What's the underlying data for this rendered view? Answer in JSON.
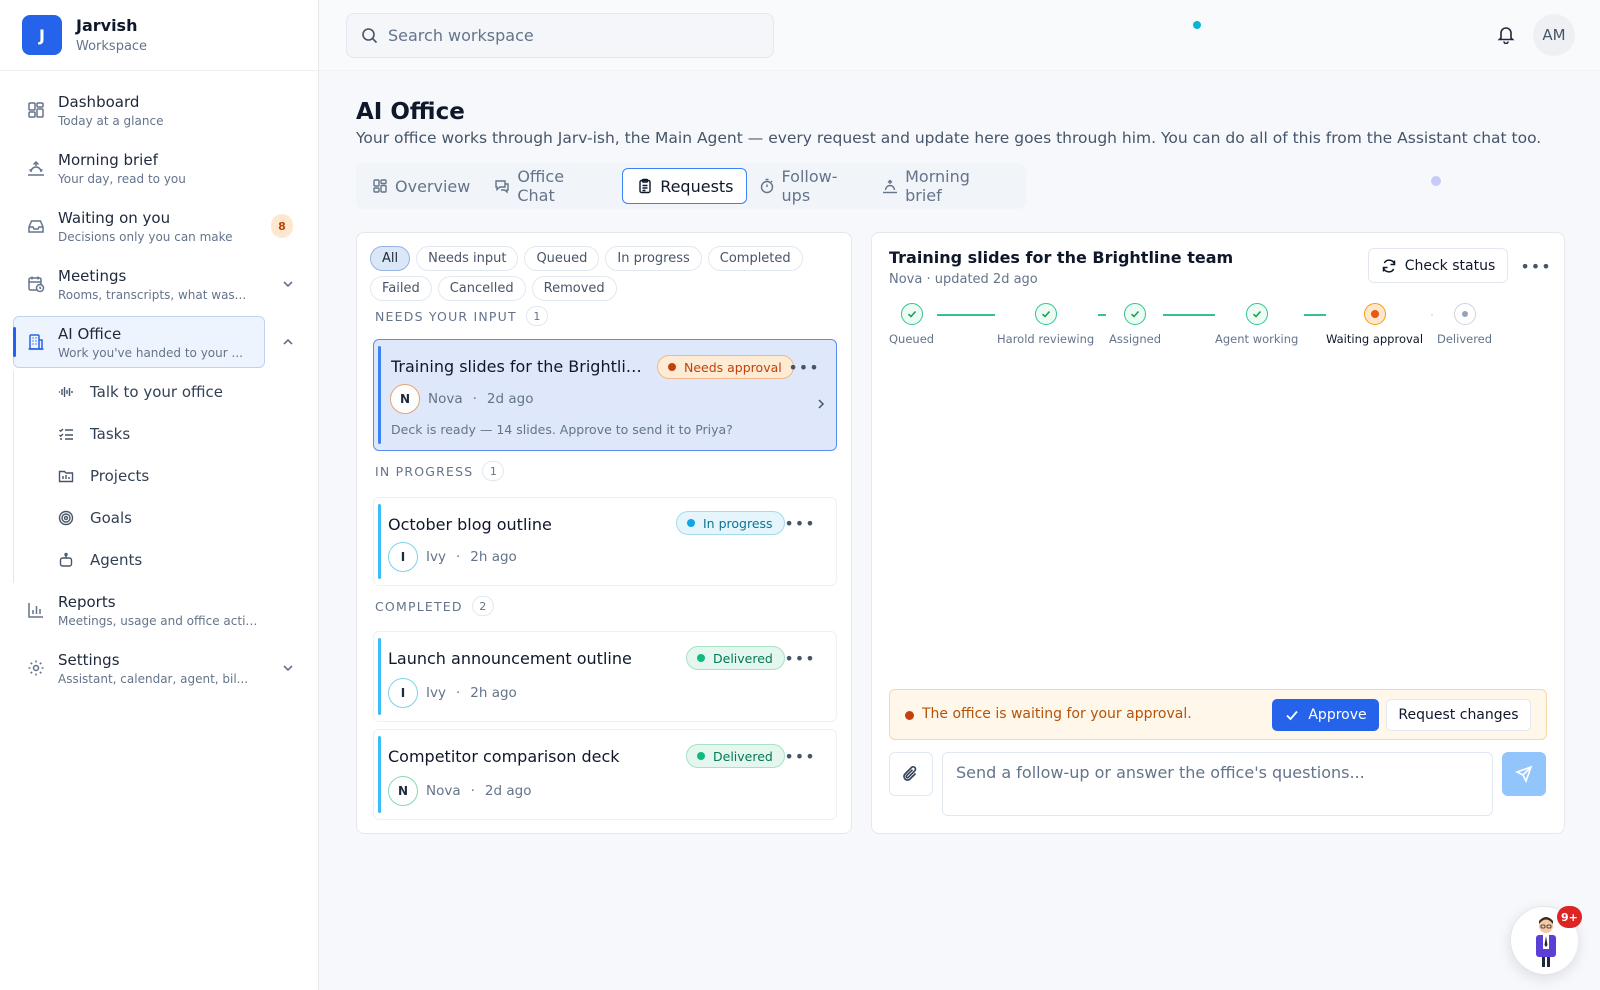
{
  "brand": {
    "initial": "J",
    "name": "Jarvish",
    "subtitle": "Workspace"
  },
  "sidebar": {
    "items": [
      {
        "label": "Dashboard",
        "sub": "Today at a glance",
        "icon": "dashboard-grid-icon"
      },
      {
        "label": "Morning brief",
        "sub": "Your day, read to you",
        "icon": "sunrise-icon"
      },
      {
        "label": "Waiting on you",
        "sub": "Decisions only you can make",
        "icon": "inbox-icon",
        "badge": "8"
      },
      {
        "label": "Meetings",
        "sub": "Rooms, transcripts, what was...",
        "icon": "calendar-clock-icon"
      },
      {
        "label": "AI Office",
        "sub": "Work you've handed to your ...",
        "icon": "building-icon"
      },
      {
        "label": "Reports",
        "sub": "Meetings, usage and office activity",
        "icon": "bar-chart-icon"
      },
      {
        "label": "Settings",
        "sub": "Assistant, calendar, agent, bil...",
        "icon": "gear-icon"
      }
    ],
    "ai_office_children": [
      {
        "label": "Talk to your office",
        "icon": "audio-wave-icon"
      },
      {
        "label": "Tasks",
        "icon": "checklist-icon"
      },
      {
        "label": "Projects",
        "icon": "folder-icon"
      },
      {
        "label": "Goals",
        "icon": "target-icon"
      },
      {
        "label": "Agents",
        "icon": "robot-icon"
      }
    ]
  },
  "topbar": {
    "search_placeholder": "Search workspace",
    "user_initials": "AM"
  },
  "page": {
    "title": "AI Office",
    "description": "Your office works through Jarv-ish, the Main Agent — every request and update here goes through him. You can do all of this from the Assistant chat too."
  },
  "tabs": [
    {
      "label": "Overview",
      "icon": "grid-icon",
      "active": false
    },
    {
      "label": "Office Chat",
      "icon": "chat-icon",
      "active": false
    },
    {
      "label": "Requests",
      "icon": "clipboard-icon",
      "active": true
    },
    {
      "label": "Follow-ups",
      "icon": "timer-icon",
      "active": false
    },
    {
      "label": "Morning brief",
      "icon": "sunrise-icon",
      "active": false
    }
  ],
  "filters": [
    "All",
    "Needs input",
    "Queued",
    "In progress",
    "Completed",
    "Failed",
    "Cancelled",
    "Removed"
  ],
  "sections": {
    "needs_input": {
      "label": "NEEDS YOUR INPUT",
      "count": "1"
    },
    "in_progress": {
      "label": "IN PROGRESS",
      "count": "1"
    },
    "completed": {
      "label": "COMPLETED",
      "count": "2"
    }
  },
  "requests": [
    {
      "title": "Training slides for the Brightline team",
      "status": "Needs approval",
      "agent_initial": "N",
      "agent": "Nova",
      "time": "2d ago",
      "preview": "Deck is ready — 14 slides. Approve to send it to Priya?"
    },
    {
      "title": "October blog outline",
      "status": "In progress",
      "agent_initial": "I",
      "agent": "Ivy",
      "time": "2h ago"
    },
    {
      "title": "Launch announcement outline",
      "status": "Delivered",
      "agent_initial": "I",
      "agent": "Ivy",
      "time": "2h ago"
    },
    {
      "title": "Competitor comparison deck",
      "status": "Delivered",
      "agent_initial": "N",
      "agent": "Nova",
      "time": "2d ago"
    }
  ],
  "detail": {
    "title": "Training slides for the Brightline team",
    "meta": "Nova · updated 2d ago",
    "check_status_label": "Check status",
    "steps": [
      {
        "label": "Queued",
        "state": "done"
      },
      {
        "label": "Harold reviewing",
        "state": "done"
      },
      {
        "label": "Assigned",
        "state": "done"
      },
      {
        "label": "Agent working",
        "state": "done"
      },
      {
        "label": "Waiting approval",
        "state": "current"
      },
      {
        "label": "Delivered",
        "state": "pending"
      }
    ],
    "approval_text": "The office is waiting for your approval.",
    "approve_label": "Approve",
    "request_changes_label": "Request changes",
    "message_placeholder": "Send a follow-up or answer the office's questions..."
  },
  "assistant": {
    "badge": "9+"
  },
  "colors": {
    "accent": "#2563eb",
    "approval": "#c2410c",
    "in_progress": "#0ea5e9",
    "delivered": "#10b981"
  }
}
